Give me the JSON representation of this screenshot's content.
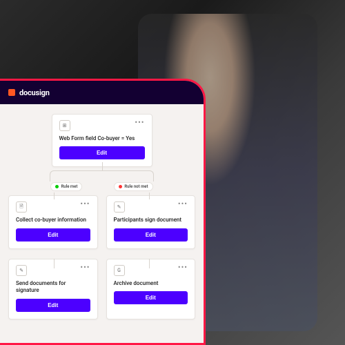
{
  "brand": {
    "name": "docusign"
  },
  "workflow": {
    "root": {
      "title": "Web Form field Co-buyer = Yes",
      "action": "Edit",
      "icon_glyph": "⊞"
    },
    "branches": {
      "left_label": "Rule met",
      "right_label": "Rule not met"
    },
    "nodes": {
      "a": {
        "title": "Collect co-buyer information",
        "action": "Edit",
        "icon_glyph": "🗎"
      },
      "b": {
        "title": "Participants sign document",
        "action": "Edit",
        "icon_glyph": "✎"
      },
      "c": {
        "title": "Send documents for signature",
        "action": "Edit",
        "icon_glyph": "✎"
      },
      "d": {
        "title": "Archive document",
        "action": "Edit",
        "icon_glyph": "G"
      }
    }
  }
}
